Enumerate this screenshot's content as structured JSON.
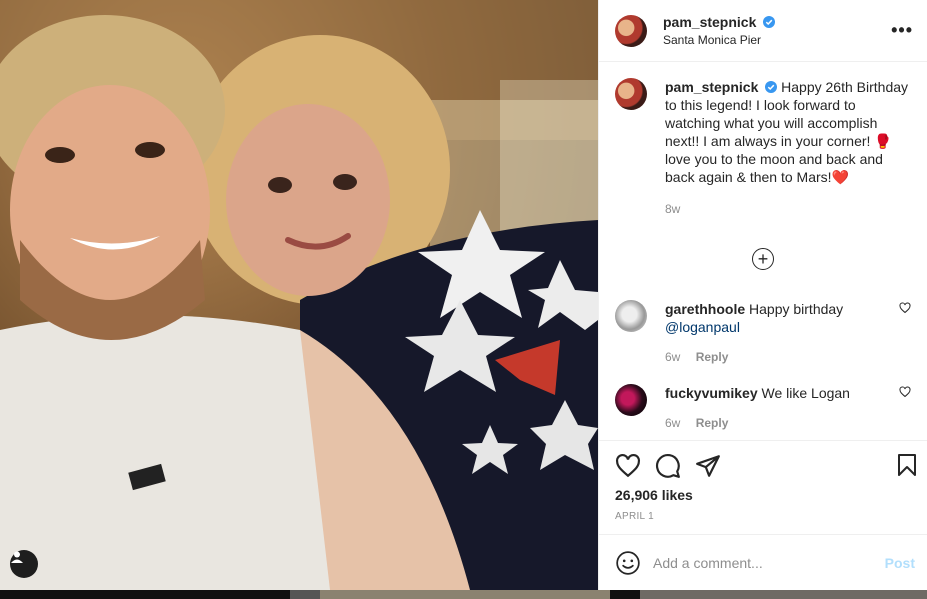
{
  "post": {
    "username": "pam_stepnick",
    "location": "Santa Monica Pier",
    "more_icon": "more-horizontal-icon",
    "caption_text": "Happy 26th Birthday to this legend! I look forward to watching what you will accomplish next!! I am always in your corner! 🥊 love you to the moon and back and back again & then to Mars!❤️",
    "caption_time": "8w",
    "load_more_icon": "plus-circle-icon"
  },
  "comments": [
    {
      "username": "garethhoole",
      "text": "Happy birthday ",
      "mention": "@loganpaul",
      "time": "6w",
      "reply_label": "Reply"
    },
    {
      "username": "fuckyvumikey",
      "text": "We like Logan",
      "mention": "",
      "time": "6w",
      "reply_label": "Reply"
    }
  ],
  "actions": {
    "likes": "26,906 likes",
    "date": "APRIL 1",
    "icons": [
      "heart-icon",
      "comment-icon",
      "share-icon",
      "bookmark-icon"
    ]
  },
  "add_comment": {
    "placeholder": "Add a comment...",
    "post_label": "Post",
    "emoji_icon": "emoji-icon"
  },
  "colors": {
    "verified": "#3897f0",
    "post_disabled": "#b2dffc",
    "mention": "#00376b",
    "muted": "#8e8e8e"
  }
}
